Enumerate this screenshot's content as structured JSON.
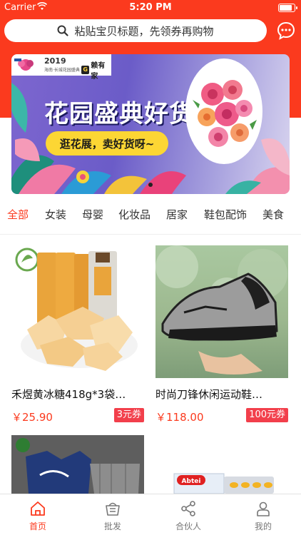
{
  "status_bar": {
    "carrier": "Carrier",
    "time": "5:20 PM"
  },
  "search": {
    "placeholder": "粘贴宝贝标题，先领券再购物",
    "icon": "search-icon"
  },
  "message_icon": "message-dots-icon",
  "banner": {
    "year": "2019",
    "year_sub": "海南·长城花园盛典",
    "brand": "赖有家",
    "title": "花园盛典好货",
    "pill": "逛花展，卖好货呀~"
  },
  "categories": [
    "全部",
    "女装",
    "母婴",
    "化妆品",
    "居家",
    "鞋包配饰",
    "美食"
  ],
  "active_category": "全部",
  "products": [
    {
      "name": "禾煜黄冰糖418g*3袋…",
      "price": "￥25.90",
      "coupon": "3元券"
    },
    {
      "name": "时尚刀锋休闲运动鞋…",
      "price": "￥118.00",
      "coupon": "100元券"
    },
    {
      "brand_text": "Abtei"
    }
  ],
  "tabbar": [
    {
      "label": "首页",
      "icon": "home-icon",
      "active": true
    },
    {
      "label": "批发",
      "icon": "basket-icon",
      "active": false
    },
    {
      "label": "合伙人",
      "icon": "share-icon",
      "active": false
    },
    {
      "label": "我的",
      "icon": "user-icon",
      "active": false
    }
  ],
  "colors": {
    "accent": "#fb3a1e",
    "coupon": "#f23f4b",
    "banner_pill": "#fcd634"
  }
}
